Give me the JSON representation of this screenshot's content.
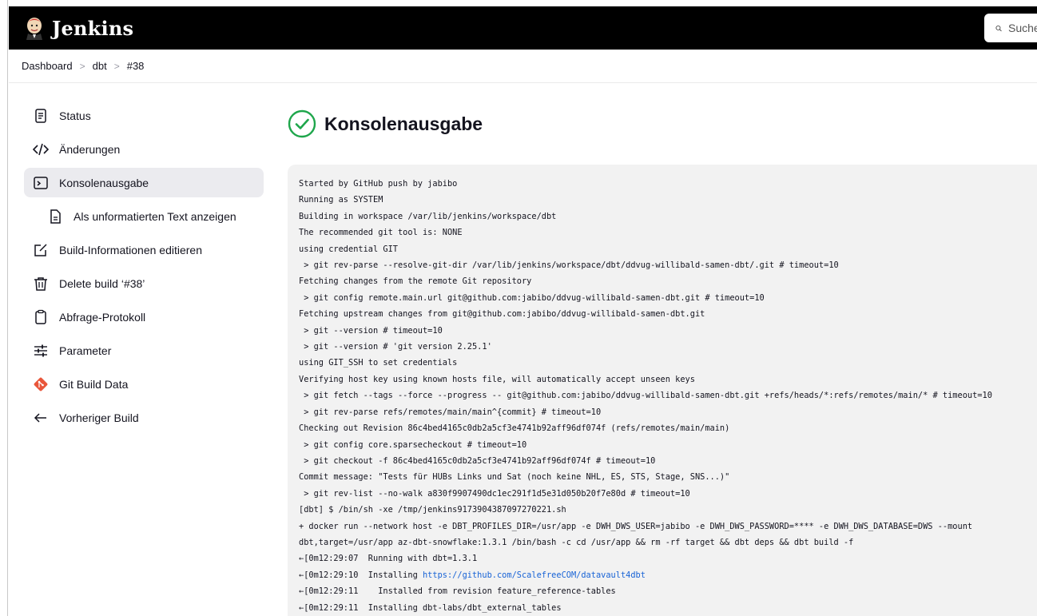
{
  "header": {
    "app_name": "Jenkins",
    "search_placeholder": "Suche"
  },
  "breadcrumb": [
    "Dashboard",
    "dbt",
    "#38"
  ],
  "sidebar": {
    "items": [
      {
        "label": "Status",
        "icon": "document-icon"
      },
      {
        "label": "Änderungen",
        "icon": "code-icon"
      },
      {
        "label": "Konsolenausgabe",
        "icon": "terminal-icon",
        "active": true
      },
      {
        "label": "Als unformatierten Text anzeigen",
        "icon": "text-file-icon",
        "sub": true
      },
      {
        "label": "Build-Informationen editieren",
        "icon": "edit-icon"
      },
      {
        "label": "Delete build ‘#38’",
        "icon": "trash-icon"
      },
      {
        "label": "Abfrage-Protokoll",
        "icon": "clipboard-icon"
      },
      {
        "label": "Parameter",
        "icon": "sliders-icon"
      },
      {
        "label": "Git Build Data",
        "icon": "git-icon"
      },
      {
        "label": "Vorheriger Build",
        "icon": "arrow-left-icon"
      }
    ]
  },
  "main": {
    "title": "Konsolenausgabe",
    "status_color": "#1ea64b"
  },
  "console": {
    "lines": [
      {
        "text": "Started by GitHub push by jabibo"
      },
      {
        "text": "Running as SYSTEM"
      },
      {
        "text": "Building in workspace /var/lib/jenkins/workspace/dbt"
      },
      {
        "text": "The recommended git tool is: NONE"
      },
      {
        "text": "using credential GIT"
      },
      {
        "text": " > git rev-parse --resolve-git-dir /var/lib/jenkins/workspace/dbt/ddvug-willibald-samen-dbt/.git # timeout=10"
      },
      {
        "text": "Fetching changes from the remote Git repository"
      },
      {
        "text": " > git config remote.main.url git@github.com:jabibo/ddvug-willibald-samen-dbt.git # timeout=10"
      },
      {
        "text": "Fetching upstream changes from git@github.com:jabibo/ddvug-willibald-samen-dbt.git"
      },
      {
        "text": " > git --version # timeout=10"
      },
      {
        "text": " > git --version # 'git version 2.25.1'"
      },
      {
        "text": "using GIT_SSH to set credentials"
      },
      {
        "text": "Verifying host key using known hosts file, will automatically accept unseen keys"
      },
      {
        "text": " > git fetch --tags --force --progress -- git@github.com:jabibo/ddvug-willibald-samen-dbt.git +refs/heads/*:refs/remotes/main/* # timeout=10"
      },
      {
        "text": " > git rev-parse refs/remotes/main/main^{commit} # timeout=10"
      },
      {
        "text": "Checking out Revision 86c4bed4165c0db2a5cf3e4741b92aff96df074f (refs/remotes/main/main)"
      },
      {
        "text": " > git config core.sparsecheckout # timeout=10"
      },
      {
        "text": " > git checkout -f 86c4bed4165c0db2a5cf3e4741b92aff96df074f # timeout=10"
      },
      {
        "text": "Commit message: \"Tests für HUBs Links und Sat (noch keine NHL, ES, STS, Stage, SNS...)\""
      },
      {
        "text": " > git rev-list --no-walk a830f9907490dc1ec291f1d5e31d050b20f7e80d # timeout=10"
      },
      {
        "text": "[dbt] $ /bin/sh -xe /tmp/jenkins9173904387097270221.sh"
      },
      {
        "text": "+ docker run --network host -e DBT_PROFILES_DIR=/usr/app -e DWH_DWS_USER=jabibo -e DWH_DWS_PASSWORD=**** -e DWH_DWS_DATABASE=DWS --mount"
      },
      {
        "text": "dbt,target=/usr/app az-dbt-snowflake:1.3.1 /bin/bash -c cd /usr/app && rm -rf target && dbt deps && dbt build -f"
      },
      {
        "text": "←[0m12:29:07  Running with dbt=1.3.1"
      },
      {
        "text": "←[0m12:29:10  Installing ",
        "link": "https://github.com/ScalefreeCOM/datavault4dbt"
      },
      {
        "text": "←[0m12:29:11    Installed from revision feature_reference-tables"
      },
      {
        "text": "←[0m12:29:11  Installing dbt-labs/dbt_external_tables"
      }
    ]
  }
}
